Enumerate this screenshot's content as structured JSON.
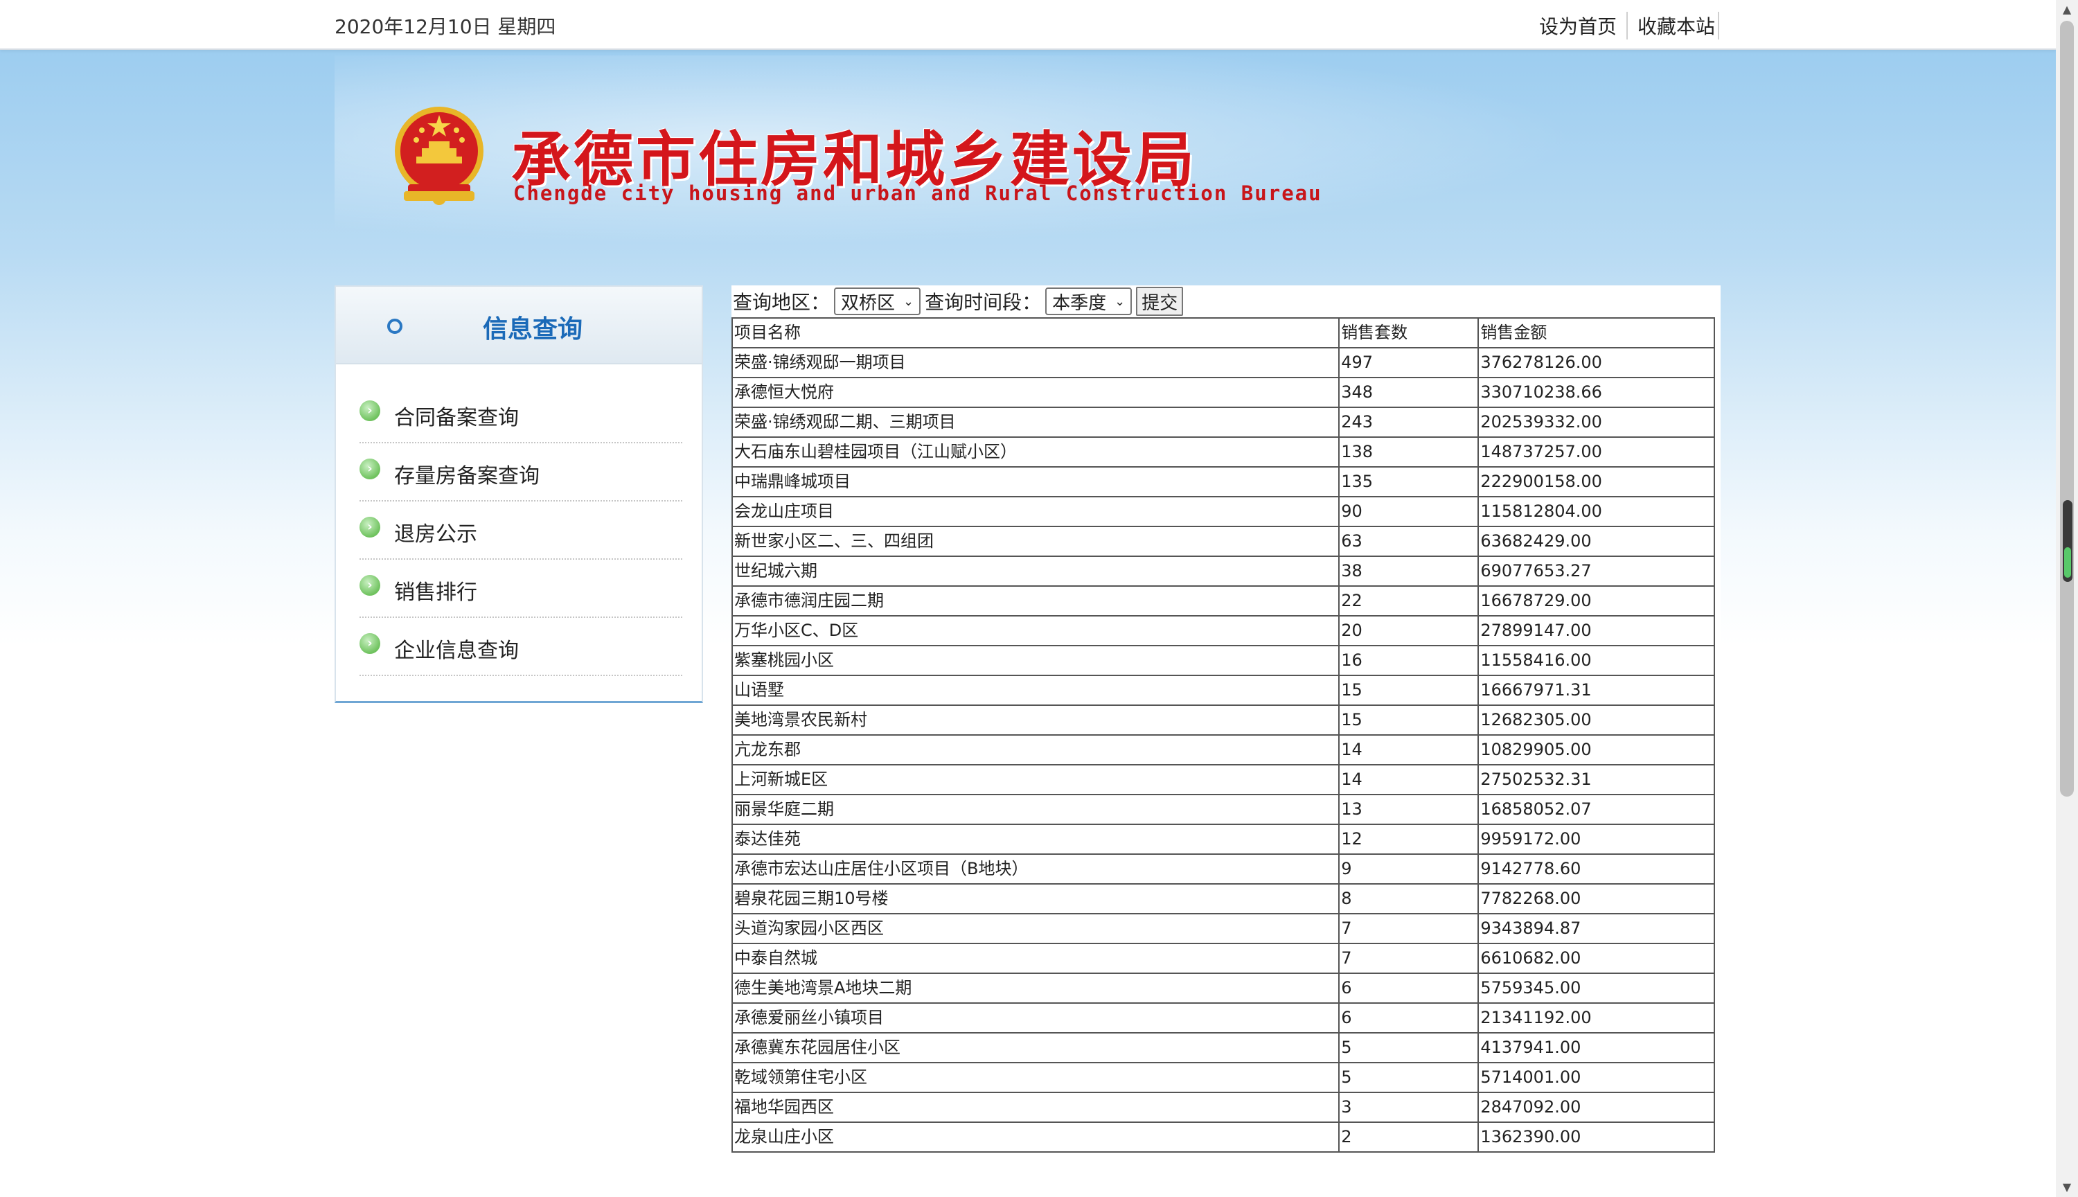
{
  "topbar": {
    "date": "2020年12月10日  星期四",
    "links": [
      "设为首页",
      "收藏本站"
    ]
  },
  "header": {
    "title_cn": "承德市住房和城乡建设局",
    "title_en": "Chengde city housing and urban and Rural Construction Bureau",
    "emblem_icon": "national-emblem-icon"
  },
  "sidebar": {
    "title": "信息查询",
    "items": [
      {
        "label": "合同备案查询"
      },
      {
        "label": "存量房备案查询"
      },
      {
        "label": "退房公示"
      },
      {
        "label": "销售排行"
      },
      {
        "label": "企业信息查询"
      }
    ]
  },
  "query": {
    "region_label": "查询地区：",
    "region_value": "双桥区",
    "period_label": "查询时间段：",
    "period_value": "本季度",
    "submit_label": "提交"
  },
  "table": {
    "headers": [
      "项目名称",
      "销售套数",
      "销售金额"
    ],
    "rows": [
      [
        "荣盛·锦绣观邸一期项目",
        "497",
        "376278126.00"
      ],
      [
        "承德恒大悦府",
        "348",
        "330710238.66"
      ],
      [
        "荣盛·锦绣观邸二期、三期项目",
        "243",
        "202539332.00"
      ],
      [
        "大石庙东山碧桂园项目（江山赋小区）",
        "138",
        "148737257.00"
      ],
      [
        "中瑞鼎峰城项目",
        "135",
        "222900158.00"
      ],
      [
        "会龙山庄项目",
        "90",
        "115812804.00"
      ],
      [
        "新世家小区二、三、四组团",
        "63",
        "63682429.00"
      ],
      [
        "世纪城六期",
        "38",
        "69077653.27"
      ],
      [
        "承德市德润庄园二期",
        "22",
        "16678729.00"
      ],
      [
        "万华小区C、D区",
        "20",
        "27899147.00"
      ],
      [
        "紫塞桃园小区",
        "16",
        "11558416.00"
      ],
      [
        "山语墅",
        "15",
        "16667971.31"
      ],
      [
        "美地湾景农民新村",
        "15",
        "12682305.00"
      ],
      [
        "亢龙东郡",
        "14",
        "10829905.00"
      ],
      [
        "上河新城E区",
        "14",
        "27502532.31"
      ],
      [
        "丽景华庭二期",
        "13",
        "16858052.07"
      ],
      [
        "泰达佳苑",
        "12",
        "9959172.00"
      ],
      [
        "承德市宏达山庄居住小区项目（B地块）",
        "9",
        "9142778.60"
      ],
      [
        "碧泉花园三期10号楼",
        "8",
        "7782268.00"
      ],
      [
        "头道沟家园小区西区",
        "7",
        "9343894.87"
      ],
      [
        "中泰自然城",
        "7",
        "6610682.00"
      ],
      [
        "德生美地湾景A地块二期",
        "6",
        "5759345.00"
      ],
      [
        "承德爱丽丝小镇项目",
        "6",
        "21341192.00"
      ],
      [
        "承德冀东花园居住小区",
        "5",
        "4137941.00"
      ],
      [
        "乾域领第住宅小区",
        "5",
        "5714001.00"
      ],
      [
        "福地华园西区",
        "3",
        "2847092.00"
      ],
      [
        "龙泉山庄小区",
        "2",
        "1362390.00"
      ]
    ]
  }
}
